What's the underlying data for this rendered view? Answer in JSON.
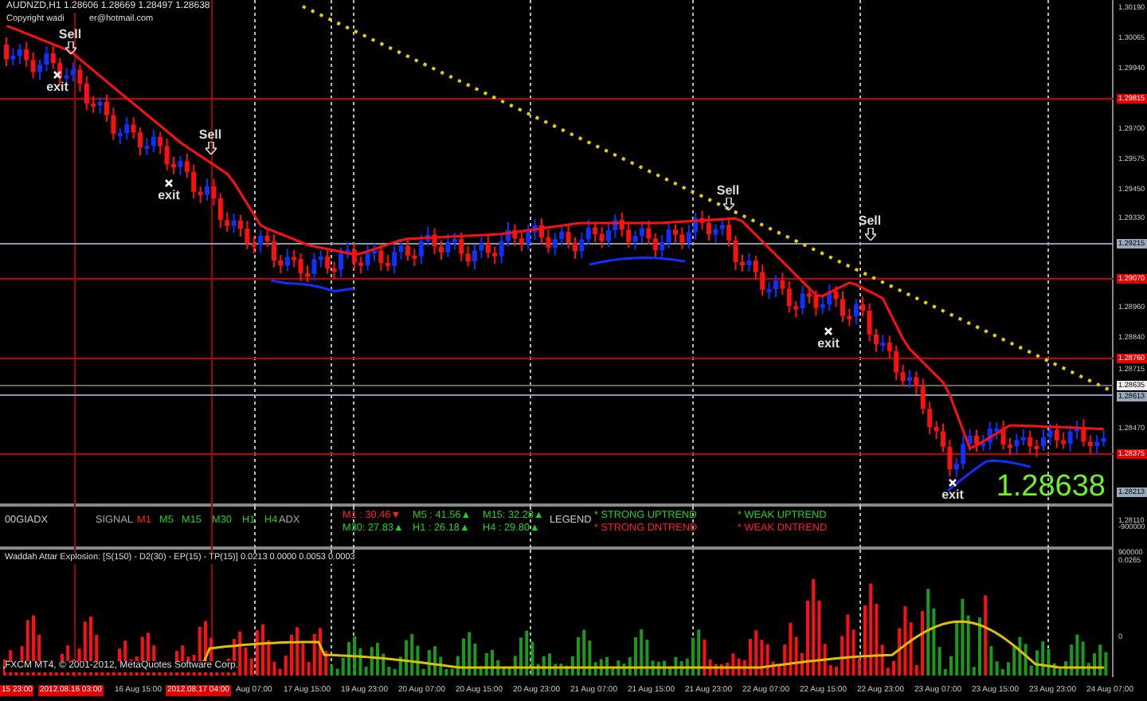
{
  "chart": {
    "symbol_line": "AUDNZD,H1  1.28606 1.28669 1.28497 1.28638",
    "copyright_parts": [
      "Copyright wadi",
      "er@hotmail.com"
    ],
    "last_price": "1.28638",
    "signals": [
      {
        "kind": "sell",
        "label": "Sell"
      },
      {
        "kind": "exit",
        "label": "exit"
      },
      {
        "kind": "sell",
        "label": "Sell"
      },
      {
        "kind": "exit",
        "label": "exit"
      },
      {
        "kind": "sell",
        "label": "Sell"
      },
      {
        "kind": "sell",
        "label": "Sell"
      },
      {
        "kind": "exit",
        "label": "exit"
      },
      {
        "kind": "exit",
        "label": "exit"
      }
    ],
    "price_axis": [
      {
        "text": "1.30190",
        "kind": "plain"
      },
      {
        "text": "1.30065",
        "kind": "plain"
      },
      {
        "text": "1.29940",
        "kind": "plain"
      },
      {
        "text": "1.29815",
        "kind": "red"
      },
      {
        "text": "1.29700",
        "kind": "plain"
      },
      {
        "text": "1.29575",
        "kind": "plain"
      },
      {
        "text": "1.29450",
        "kind": "plain"
      },
      {
        "text": "1.29330",
        "kind": "plain"
      },
      {
        "text": "1.29215",
        "kind": "grey"
      },
      {
        "text": "1.29070",
        "kind": "red"
      },
      {
        "text": "1.28960",
        "kind": "plain"
      },
      {
        "text": "1.28840",
        "kind": "plain"
      },
      {
        "text": "1.28760",
        "kind": "red"
      },
      {
        "text": "1.28715",
        "kind": "plain"
      },
      {
        "text": "1.28635",
        "kind": "white"
      },
      {
        "text": "1.28613",
        "kind": "grey"
      },
      {
        "text": "1.28470",
        "kind": "plain"
      },
      {
        "text": "1.28375",
        "kind": "red"
      },
      {
        "text": "1.28213",
        "kind": "grey"
      },
      {
        "text": "1.28110",
        "kind": "plain"
      }
    ]
  },
  "adx_panel": {
    "title": "00GIADX",
    "signal_label": "SIGNAL",
    "timeframes": [
      {
        "text": "M1",
        "color": "#ff2020"
      },
      {
        "text": "M5",
        "color": "#20d020"
      },
      {
        "text": "M15",
        "color": "#20d020"
      },
      {
        "text": "M30",
        "color": "#20d020"
      },
      {
        "text": "H1",
        "color": "#20d020"
      },
      {
        "text": "H4",
        "color": "#20d020"
      }
    ],
    "adx_label": "ADX",
    "readings": [
      {
        "text": "M1  : 30.46▼",
        "color": "#ff2020"
      },
      {
        "text": "M30: 27.83▲",
        "color": "#20d020"
      },
      {
        "text": "M5  : 41.56▲",
        "color": "#20d020"
      },
      {
        "text": "H1  : 26.18▲",
        "color": "#20d020"
      },
      {
        "text": "M15: 32.28▲",
        "color": "#20d020"
      },
      {
        "text": "H4  : 29.80▲",
        "color": "#20d020"
      }
    ],
    "legend_label": "LEGEND",
    "legend": [
      {
        "text": "* STRONG UPTREND",
        "color": "#20d020"
      },
      {
        "text": "* STRONG DNTREND",
        "color": "#ff2020"
      },
      {
        "text": "* WEAK UPTREND",
        "color": "#20d020"
      },
      {
        "text": "* WEAK DNTREND",
        "color": "#ff2020"
      }
    ],
    "axis": [
      "-900000",
      "900000"
    ]
  },
  "explosion_panel": {
    "title": "Waddah Attar Explosion: [S(150) - D2(30) - EP(15) - TP(15)] 0.0213 0.0000 0.0053 0.0003",
    "axis": [
      "0.0265",
      "0"
    ],
    "footer": "FXCM MT4, © 2001-2012, MetaQuotes Software Corp."
  },
  "time_axis": [
    {
      "text": "15 23:00",
      "kind": "marker"
    },
    {
      "text": "2012.08.16 03:00",
      "kind": "marker"
    },
    {
      "text": "16 Aug 15:00",
      "kind": "plain"
    },
    {
      "text": "2012.08.17 04:00",
      "kind": "marker"
    },
    {
      "text": "Aug 07:00",
      "kind": "plain"
    },
    {
      "text": "17 Aug 15:00",
      "kind": "plain"
    },
    {
      "text": "19 Aug 23:00",
      "kind": "plain"
    },
    {
      "text": "20 Aug 07:00",
      "kind": "plain"
    },
    {
      "text": "20 Aug 15:00",
      "kind": "plain"
    },
    {
      "text": "20 Aug 23:00",
      "kind": "plain"
    },
    {
      "text": "21 Aug 07:00",
      "kind": "plain"
    },
    {
      "text": "21 Aug 15:00",
      "kind": "plain"
    },
    {
      "text": "21 Aug 23:00",
      "kind": "plain"
    },
    {
      "text": "22 Aug 07:00",
      "kind": "plain"
    },
    {
      "text": "22 Aug 15:00",
      "kind": "plain"
    },
    {
      "text": "22 Aug 23:00",
      "kind": "plain"
    },
    {
      "text": "23 Aug 07:00",
      "kind": "plain"
    },
    {
      "text": "23 Aug 15:00",
      "kind": "plain"
    },
    {
      "text": "23 Aug 23:00",
      "kind": "plain"
    },
    {
      "text": "24 Aug 07:00",
      "kind": "plain"
    }
  ]
}
